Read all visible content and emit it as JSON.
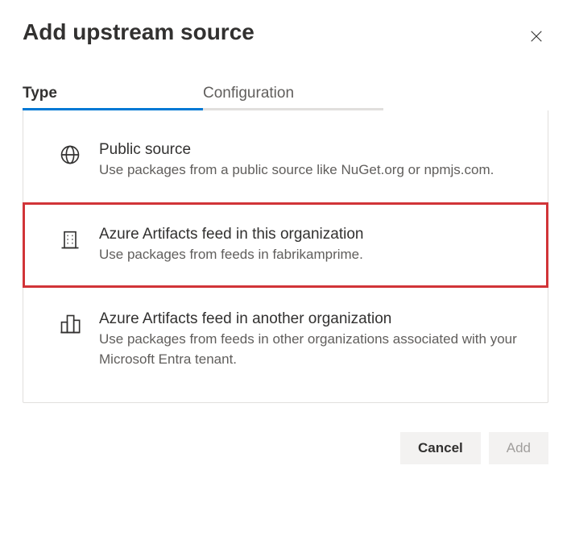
{
  "dialog": {
    "title": "Add upstream source"
  },
  "tabs": {
    "type": "Type",
    "configuration": "Configuration"
  },
  "options": {
    "public": {
      "title": "Public source",
      "desc": "Use packages from a public source like NuGet.org or npmjs.com."
    },
    "thisOrg": {
      "title": "Azure Artifacts feed in this organization",
      "desc": "Use packages from feeds in fabrikamprime."
    },
    "otherOrg": {
      "title": "Azure Artifacts feed in another organization",
      "desc": "Use packages from feeds in other organizations associated with your Microsoft Entra tenant."
    }
  },
  "buttons": {
    "cancel": "Cancel",
    "add": "Add"
  }
}
